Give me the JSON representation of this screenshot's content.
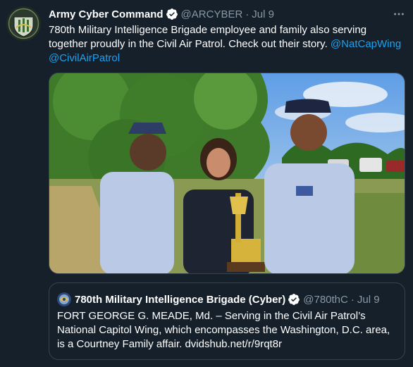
{
  "colors": {
    "background": "#15202b",
    "text_primary": "#ffffff",
    "text_secondary": "#8899a6",
    "link": "#1da1f2",
    "border": "#38444d"
  },
  "tweet": {
    "author": {
      "display_name": "Army Cyber Command",
      "handle": "@ARCYBER",
      "verified": true,
      "avatar_icon": "army-cyber-command-emblem"
    },
    "separator": "·",
    "date": "Jul 9",
    "more_icon": "ellipsis-icon",
    "text": "780th Military Intelligence Brigade employee and family also serving together proudly in the Civil Air Patrol. Check out their story.",
    "mentions": [
      "@NatCapWing",
      "@CivilAirPatrol"
    ],
    "media": {
      "type": "photo",
      "icon": "photo-family-with-trophy"
    },
    "quote": {
      "author": {
        "display_name": "780th Military Intelligence Brigade (Cyber)",
        "handle": "@780thC",
        "verified": true,
        "avatar_icon": "brigade-emblem"
      },
      "date": "Jul 9",
      "text": "FORT GEORGE G. MEADE, Md. – Serving in the Civil Air Patrol’s National Capitol Wing, which encompasses the Washington, D.C. area, is a Courtney Family affair. dvidshub.net/r/9rqt8r"
    }
  }
}
